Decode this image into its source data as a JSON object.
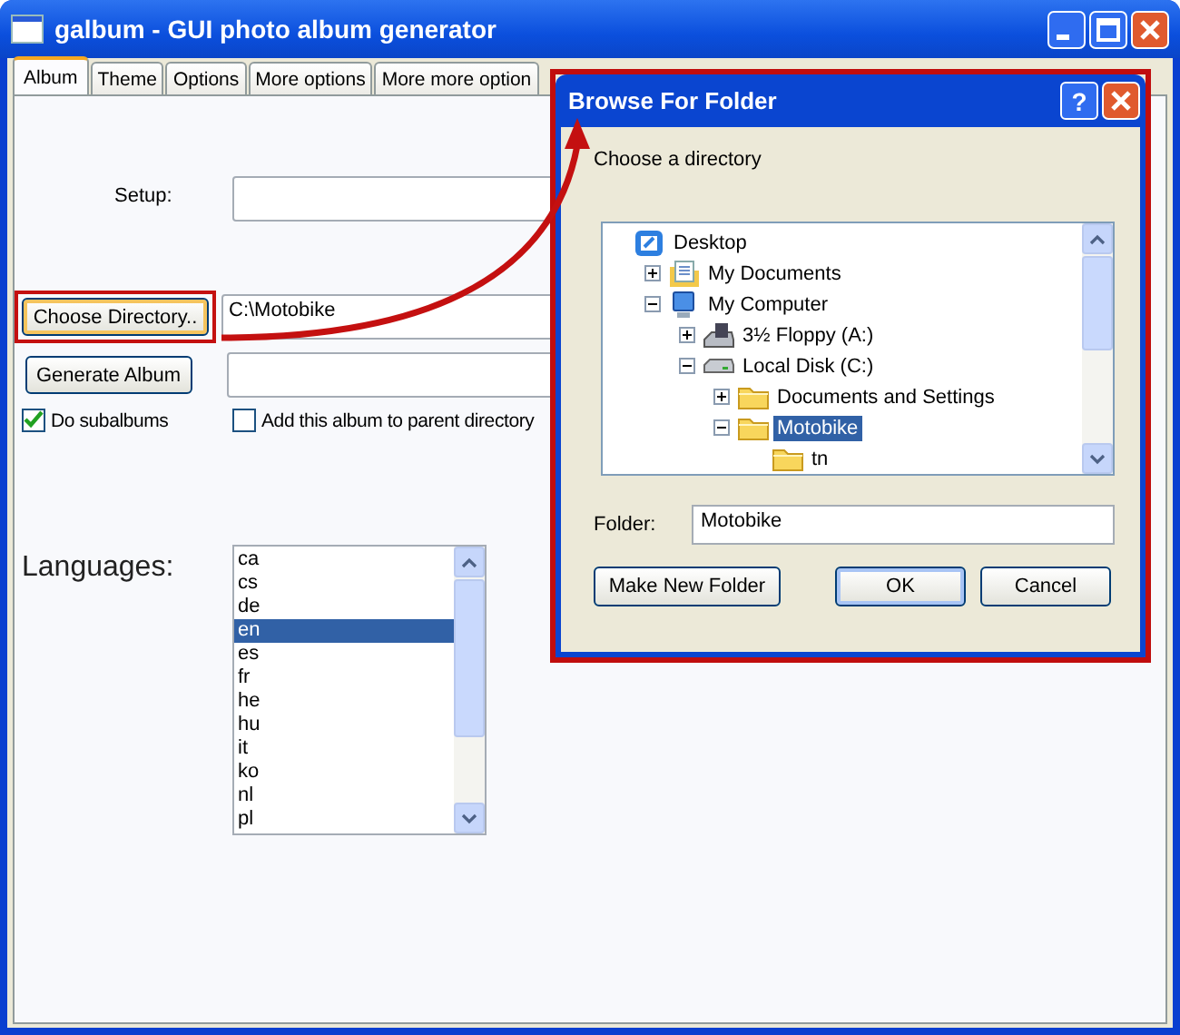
{
  "window": {
    "title": "galbum - GUI photo album generator"
  },
  "tabs": [
    {
      "label": "Album",
      "selected": true
    },
    {
      "label": "Theme",
      "selected": false
    },
    {
      "label": "Options",
      "selected": false
    },
    {
      "label": "More options",
      "selected": false
    },
    {
      "label": "More more option",
      "selected": false
    }
  ],
  "album": {
    "setup_label": "Setup:",
    "choose_button": "Choose Directory..",
    "directory_value": "C:\\Motobike",
    "generate_button": "Generate Album",
    "checkboxes": [
      {
        "label": "Do subalbums",
        "checked": true
      },
      {
        "label": "Add this album to parent directory",
        "checked": false
      }
    ],
    "languages_label": "Languages:",
    "languages": [
      {
        "label": "ca",
        "selected": false
      },
      {
        "label": "cs",
        "selected": false
      },
      {
        "label": "de",
        "selected": false
      },
      {
        "label": "en",
        "selected": true
      },
      {
        "label": "es",
        "selected": false
      },
      {
        "label": "fr",
        "selected": false
      },
      {
        "label": "he",
        "selected": false
      },
      {
        "label": "hu",
        "selected": false
      },
      {
        "label": "it",
        "selected": false
      },
      {
        "label": "ko",
        "selected": false
      },
      {
        "label": "nl",
        "selected": false
      },
      {
        "label": "pl",
        "selected": false
      }
    ]
  },
  "dialog": {
    "title": "Browse For Folder",
    "help_button": "?",
    "prompt": "Choose a directory",
    "tree": [
      {
        "label": "Desktop",
        "kind": "desktop",
        "selected": false,
        "children": [
          {
            "label": "My Documents",
            "kind": "documents",
            "expanded": false,
            "selected": false
          },
          {
            "label": "My Computer",
            "kind": "computer",
            "expanded": true,
            "selected": false,
            "children": [
              {
                "label": "3½ Floppy (A:)",
                "kind": "floppy",
                "expanded": false,
                "selected": false
              },
              {
                "label": "Local Disk (C:)",
                "kind": "disk",
                "expanded": true,
                "selected": false,
                "children": [
                  {
                    "label": "Documents and Settings",
                    "kind": "folder",
                    "expanded": false,
                    "selected": false
                  },
                  {
                    "label": "Motobike",
                    "kind": "folder",
                    "expanded": true,
                    "selected": true,
                    "children": [
                      {
                        "label": "tn",
                        "kind": "folder",
                        "selected": false
                      }
                    ]
                  }
                ]
              }
            ]
          }
        ]
      }
    ],
    "folder_label": "Folder:",
    "folder_value": "Motobike",
    "buttons": [
      {
        "label": "Make New Folder"
      },
      {
        "label": "OK"
      },
      {
        "label": "Cancel"
      }
    ]
  }
}
